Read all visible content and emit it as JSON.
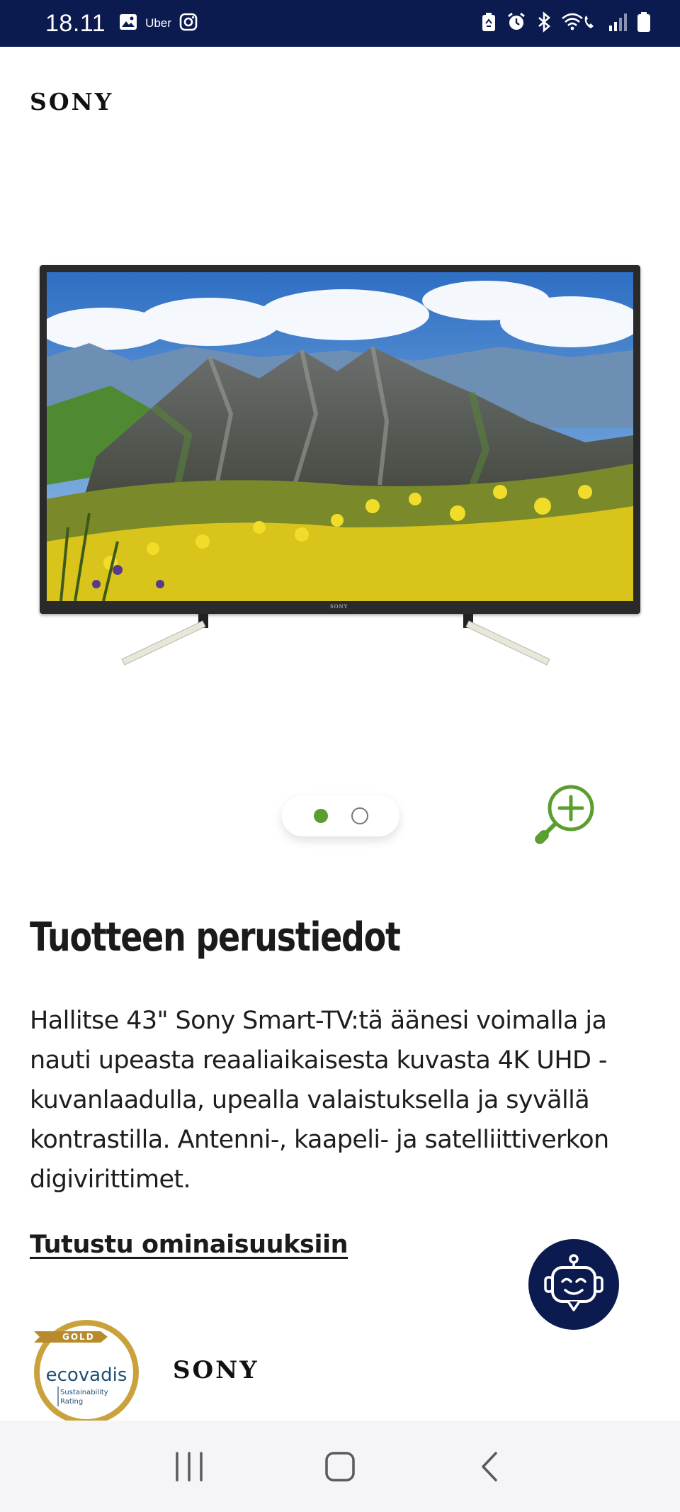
{
  "status_bar": {
    "time": "18.11",
    "app_label": "Uber",
    "icons": [
      "gallery-icon",
      "uber-icon",
      "instagram-icon",
      "recycle-icon",
      "alarm-icon",
      "bluetooth-icon",
      "wifi-call-icon",
      "signal-icon",
      "battery-icon"
    ]
  },
  "header": {
    "brand": "SONY"
  },
  "product_image": {
    "tv_brand": "SONY",
    "alt": "Sony Smart-TV"
  },
  "carousel": {
    "total": 2,
    "active_index": 0
  },
  "details": {
    "title": "Tuotteen perustiedot",
    "description": "Hallitse 43\" Sony Smart-TV:tä äänesi voimalla ja nauti upeasta reaaliaikaisesta kuvasta 4K UHD -kuvanlaadulla, upealla valaistuksella ja syvällä kontrastilla. Antenni-, kaapeli- ja satelliittiverkon digivirittimet.",
    "link": "Tutustu ominaisuuksiin"
  },
  "badges": {
    "ecovadis_level": "GOLD",
    "ecovadis_name": "ecovadis",
    "ecovadis_sub1": "Sustainability",
    "ecovadis_sub2": "Rating",
    "brand": "SONY"
  },
  "colors": {
    "navy": "#0b1a4f",
    "accent_green": "#5a9e2f",
    "gold": "#c9a23c"
  }
}
